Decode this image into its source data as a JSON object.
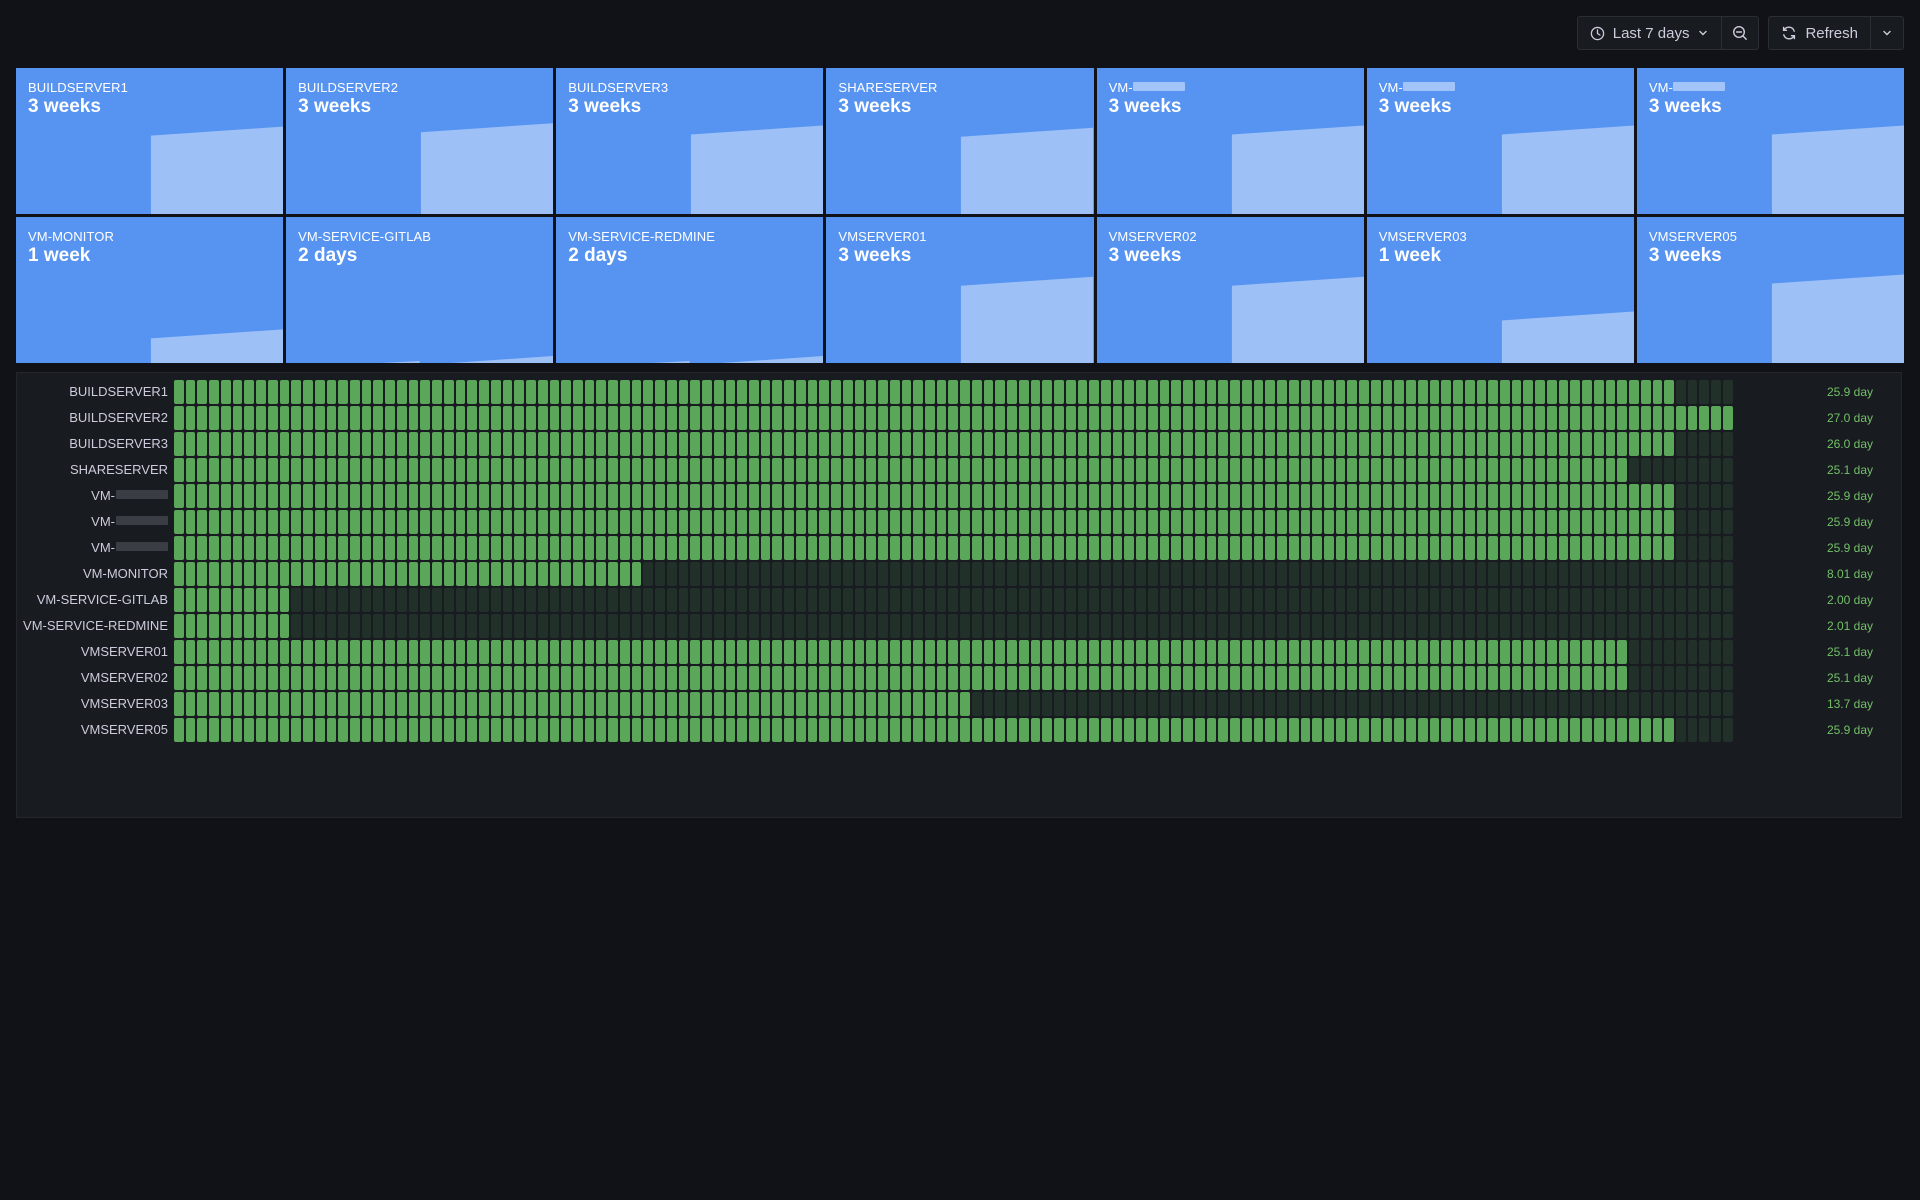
{
  "toolbar": {
    "time_range_label": "Last 7 days",
    "refresh_label": "Refresh"
  },
  "colors": {
    "background": "#111217",
    "panel": "#181b1f",
    "stat_blue": "#5794f2",
    "up_green": "#5aa75a",
    "down": "#22302a",
    "uptime_text": "#73bf69"
  },
  "stats": [
    {
      "name": "BUILDSERVER1",
      "value": "3 weeks",
      "redacted": false,
      "level": 0.7
    },
    {
      "name": "BUILDSERVER2",
      "value": "3 weeks",
      "redacted": false,
      "level": 0.73
    },
    {
      "name": "BUILDSERVER3",
      "value": "3 weeks",
      "redacted": false,
      "level": 0.71
    },
    {
      "name": "SHARESERVER",
      "value": "3 weeks",
      "redacted": false,
      "level": 0.69
    },
    {
      "name": "VM-",
      "value": "3 weeks",
      "redacted": true,
      "level": 0.71
    },
    {
      "name": "VM-",
      "value": "3 weeks",
      "redacted": true,
      "level": 0.71
    },
    {
      "name": "VM-",
      "value": "3 weeks",
      "redacted": true,
      "level": 0.71
    },
    {
      "name": "VM-MONITOR",
      "value": "1 week",
      "redacted": false,
      "level": 0.22
    },
    {
      "name": "VM-SERVICE-GITLAB",
      "value": "2 days",
      "redacted": false,
      "level": 0.05
    },
    {
      "name": "VM-SERVICE-REDMINE",
      "value": "2 days",
      "redacted": false,
      "level": 0.05
    },
    {
      "name": "VMSERVER01",
      "value": "3 weeks",
      "redacted": false,
      "level": 0.69
    },
    {
      "name": "VMSERVER02",
      "value": "3 weeks",
      "redacted": false,
      "level": 0.69
    },
    {
      "name": "VMSERVER03",
      "value": "1 week",
      "redacted": false,
      "level": 0.38
    },
    {
      "name": "VMSERVER05",
      "value": "3 weeks",
      "redacted": false,
      "level": 0.71
    }
  ],
  "history": {
    "total_slots": 133,
    "rows": [
      {
        "name": "BUILDSERVER1",
        "redacted": false,
        "up_slots": 128,
        "uptime": "25.9 day"
      },
      {
        "name": "BUILDSERVER2",
        "redacted": false,
        "up_slots": 133,
        "uptime": "27.0 day"
      },
      {
        "name": "BUILDSERVER3",
        "redacted": false,
        "up_slots": 128,
        "uptime": "26.0 day"
      },
      {
        "name": "SHARESERVER",
        "redacted": false,
        "up_slots": 124,
        "uptime": "25.1 day"
      },
      {
        "name": "VM-",
        "redacted": true,
        "up_slots": 128,
        "uptime": "25.9 day"
      },
      {
        "name": "VM-",
        "redacted": true,
        "up_slots": 128,
        "uptime": "25.9 day"
      },
      {
        "name": "VM-",
        "redacted": true,
        "up_slots": 128,
        "uptime": "25.9 day"
      },
      {
        "name": "VM-MONITOR",
        "redacted": false,
        "up_slots": 40,
        "uptime": "8.01 day"
      },
      {
        "name": "VM-SERVICE-GITLAB",
        "redacted": false,
        "up_slots": 10,
        "uptime": "2.00 day"
      },
      {
        "name": "VM-SERVICE-REDMINE",
        "redacted": false,
        "up_slots": 10,
        "uptime": "2.01 day"
      },
      {
        "name": "VMSERVER01",
        "redacted": false,
        "up_slots": 124,
        "uptime": "25.1 day"
      },
      {
        "name": "VMSERVER02",
        "redacted": false,
        "up_slots": 124,
        "uptime": "25.1 day"
      },
      {
        "name": "VMSERVER03",
        "redacted": false,
        "up_slots": 68,
        "uptime": "13.7 day"
      },
      {
        "name": "VMSERVER05",
        "redacted": false,
        "up_slots": 128,
        "uptime": "25.9 day"
      }
    ]
  }
}
